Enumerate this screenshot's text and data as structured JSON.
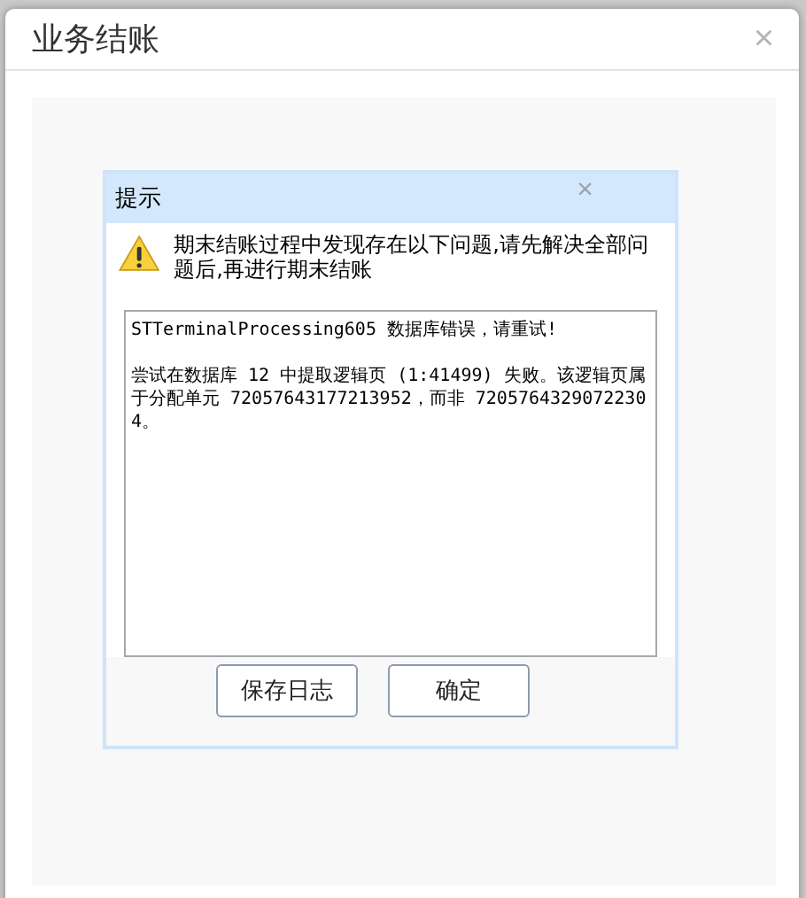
{
  "window": {
    "title": "业务结账",
    "close": "×"
  },
  "message_box": {
    "title": "提示",
    "close": "×",
    "message": "期末结账过程中发现存在以下问题,请先解决全部问题后,再进行期末结账",
    "log": [
      "STTerminalProcessing605 数据库错误，请重试!",
      "尝试在数据库 12 中提取逻辑页 (1:41499) 失败。该逻辑页属于分配单元 72057643177213952，而非 72057643290722304。"
    ],
    "buttons": [
      "保存日志",
      "确定"
    ]
  }
}
